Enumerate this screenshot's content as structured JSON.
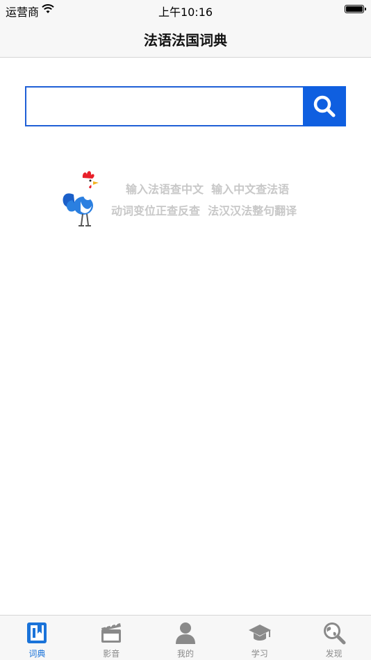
{
  "status_bar": {
    "carrier": "运营商",
    "time": "上午10:16"
  },
  "nav": {
    "title": "法语法国词典"
  },
  "search": {
    "value": "",
    "placeholder": ""
  },
  "promo": {
    "line1": "输入法语查中文  输入中文查法语",
    "line2": "动词变位正查反查  法汉汉法整句翻译"
  },
  "tabs": [
    {
      "label": "词典",
      "icon": "dictionary-icon",
      "active": true
    },
    {
      "label": "影音",
      "icon": "clapperboard-icon",
      "active": false
    },
    {
      "label": "我的",
      "icon": "user-icon",
      "active": false
    },
    {
      "label": "学习",
      "icon": "graduation-cap-icon",
      "active": false
    },
    {
      "label": "发现",
      "icon": "globe-search-icon",
      "active": false
    }
  ],
  "colors": {
    "accent": "#0f5fe0",
    "active_tab": "#1a73d9",
    "inactive_tab": "#8a8a8a",
    "hint_text": "#c8c8c8"
  }
}
